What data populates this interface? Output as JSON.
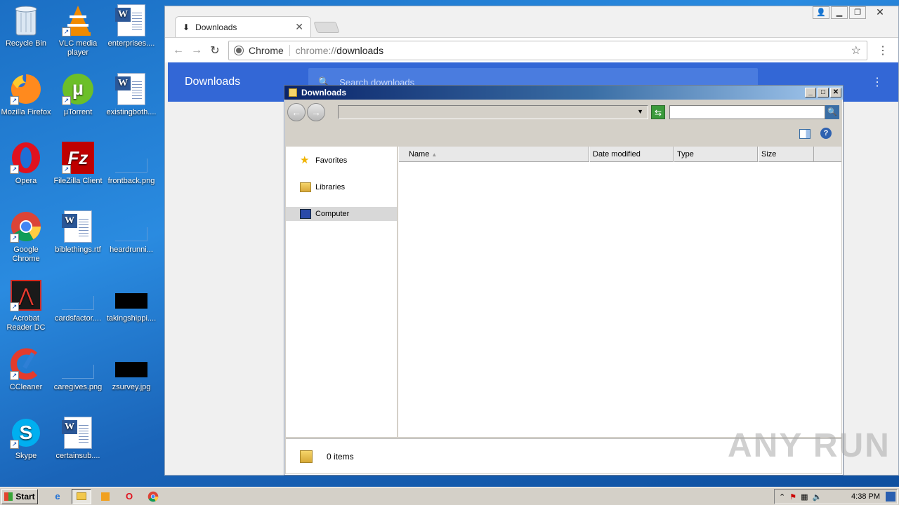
{
  "desktop": {
    "icons": [
      {
        "label": "Recycle Bin",
        "icon": "recycle-bin-icon"
      },
      {
        "label": "VLC media player",
        "icon": "vlc-icon"
      },
      {
        "label": "enterprises....",
        "icon": "word-doc-icon"
      },
      {
        "label": "Mozilla Firefox",
        "icon": "firefox-icon"
      },
      {
        "label": "µTorrent",
        "icon": "utorrent-icon"
      },
      {
        "label": "existingboth....",
        "icon": "word-doc-icon"
      },
      {
        "label": "Opera",
        "icon": "opera-icon"
      },
      {
        "label": "FileZilla Client",
        "icon": "filezilla-icon"
      },
      {
        "label": "frontback.png",
        "icon": "image-file-icon"
      },
      {
        "label": "Google Chrome",
        "icon": "chrome-icon"
      },
      {
        "label": "biblethings.rtf",
        "icon": "word-doc-icon"
      },
      {
        "label": "heardrunni...",
        "icon": "image-file-icon"
      },
      {
        "label": "Acrobat Reader DC",
        "icon": "acrobat-icon"
      },
      {
        "label": "cardsfactor....",
        "icon": "image-file-icon"
      },
      {
        "label": "takingshippi....",
        "icon": "image-file-icon"
      },
      {
        "label": "CCleaner",
        "icon": "ccleaner-icon"
      },
      {
        "label": "caregives.png",
        "icon": "image-file-icon"
      },
      {
        "label": "zsurvey.jpg",
        "icon": "image-file-icon"
      },
      {
        "label": "Skype",
        "icon": "skype-icon"
      },
      {
        "label": "certainsub....",
        "icon": "word-doc-icon"
      }
    ]
  },
  "chrome": {
    "tab_title": "Downloads",
    "site_label": "Chrome",
    "url_scheme": "chrome://",
    "url_path": "downloads",
    "page_title": "Downloads",
    "search_placeholder": "Search downloads"
  },
  "explorer": {
    "title": "Downloads",
    "nav_items": [
      "Favorites",
      "Libraries",
      "Computer"
    ],
    "selected_nav": "Computer",
    "columns": [
      "Name",
      "Date modified",
      "Type",
      "Size"
    ],
    "status": "0 items"
  },
  "watermark": "ANY RUN",
  "taskbar": {
    "start_label": "Start",
    "clock": "4:38 PM"
  },
  "colors": {
    "chrome_header": "#3367d6",
    "desktop_bg": "#1f75c9"
  }
}
